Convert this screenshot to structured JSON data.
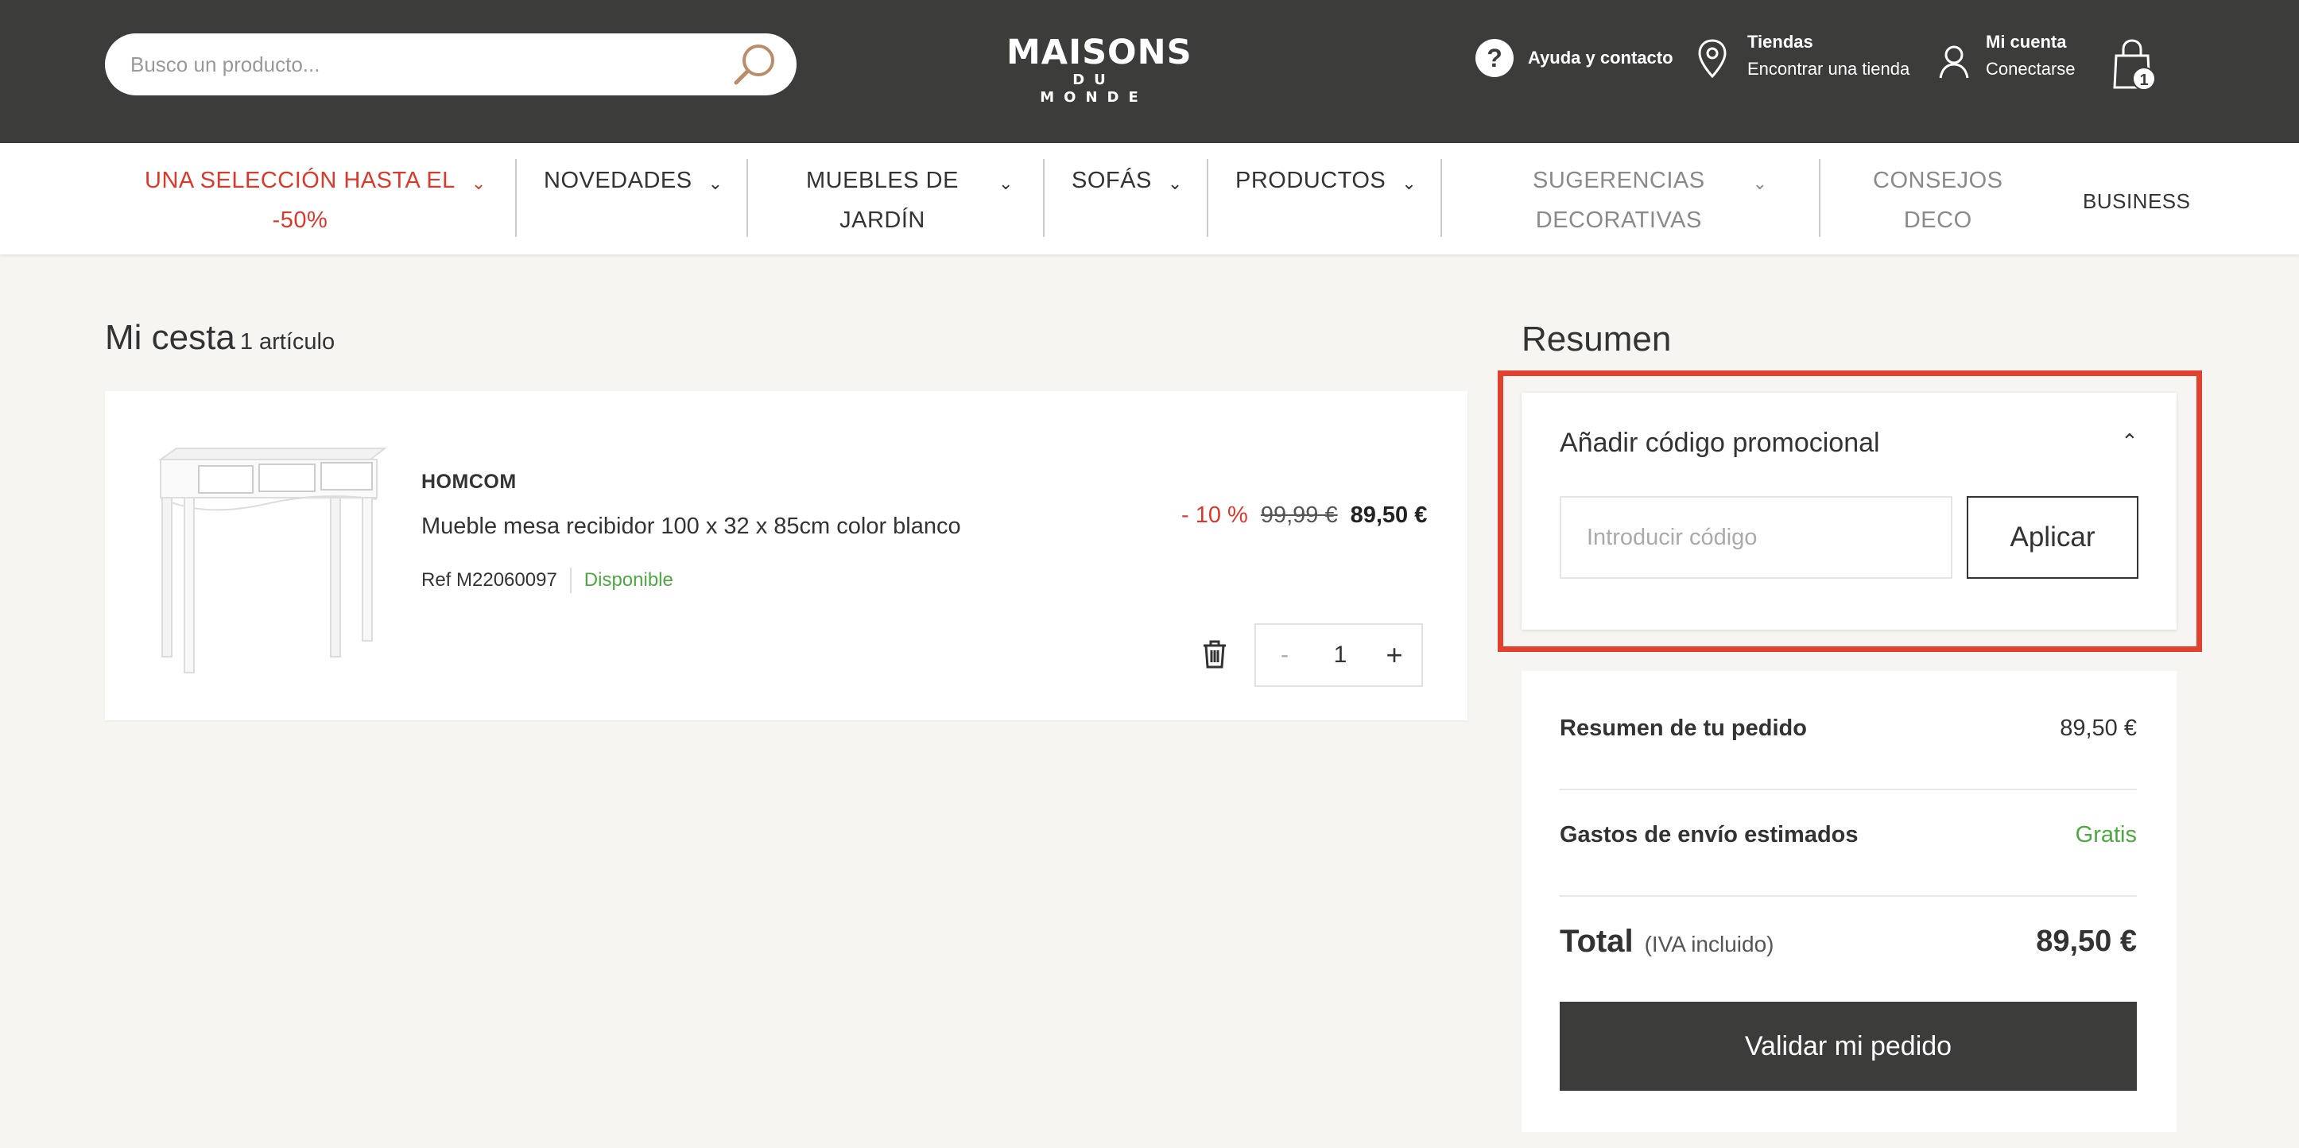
{
  "header": {
    "search_placeholder": "Busco un producto...",
    "logo_line1": "MAISONS",
    "logo_line2": "DU MONDE",
    "help_label": "Ayuda y contacto",
    "stores_title": "Tiendas",
    "stores_sub": "Encontrar una tienda",
    "account_title": "Mi cuenta",
    "account_sub": "Conectarse",
    "cart_count": "1",
    "bg_color": "#3c3c3b"
  },
  "nav": {
    "items": [
      {
        "line1": "UNA SELECCIÓN HASTA EL",
        "line2": "-50%"
      },
      {
        "line1": "NOVEDADES"
      },
      {
        "line1": "MUEBLES DE",
        "line2": "JARDÍN"
      },
      {
        "line1": "SOFÁS"
      },
      {
        "line1": "PRODUCTOS"
      },
      {
        "line1": "SUGERENCIAS",
        "line2": "DECORATIVAS"
      },
      {
        "line1": "CONSEJOS",
        "line2": "DECO"
      },
      {
        "line1": "BUSINESS"
      }
    ],
    "promo_color": "#d93a2b"
  },
  "cart": {
    "title": "Mi cesta",
    "count_label": "1 artículo",
    "item": {
      "brand": "HOMCOM",
      "name": "Mueble mesa recibidor 100 x 32 x 85cm color blanco",
      "ref": "Ref M22060097",
      "availability": "Disponible",
      "discount": "- 10 %",
      "old_price": "99,99 €",
      "price": "89,50 €",
      "quantity": "1",
      "minus": "-",
      "plus": "+"
    }
  },
  "summary": {
    "title": "Resumen",
    "promo": {
      "title": "Añadir código promocional",
      "placeholder": "Introducir código",
      "apply_label": "Aplicar",
      "highlight_color": "#e3402d"
    },
    "order_label": "Resumen de tu pedido",
    "order_value": "89,50 €",
    "shipping_label": "Gastos de envío estimados",
    "shipping_value": "Gratis",
    "total_label": "Total",
    "total_note": "(IVA incluido)",
    "total_value": "89,50 €",
    "validate_label": "Validar mi pedido"
  }
}
